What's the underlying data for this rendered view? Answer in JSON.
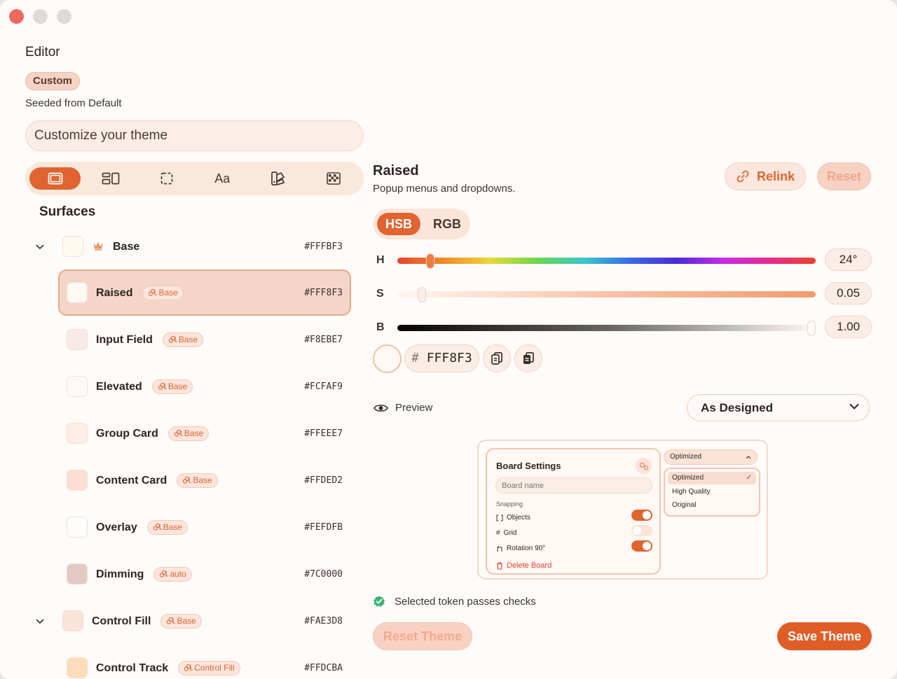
{
  "editor": {
    "title": "Editor",
    "badge": "Custom",
    "seeded": "Seeded from Default",
    "theme_input": "Customize your theme",
    "tabs": [
      {
        "name": "surfaces",
        "icon": "surface-icon",
        "active": true
      },
      {
        "name": "layout",
        "icon": "layout-icon",
        "active": false
      },
      {
        "name": "border",
        "icon": "dashed-square-icon",
        "active": false
      },
      {
        "name": "typography",
        "label": "Aa",
        "active": false
      },
      {
        "name": "palette",
        "icon": "swatchbook-icon",
        "active": false
      },
      {
        "name": "pattern",
        "icon": "checker-icon",
        "active": false
      }
    ],
    "section_title": "Surfaces",
    "tokens": [
      {
        "label": "Base",
        "hex": "#FFFBF3",
        "swatch": "#FFFBF3",
        "root": true,
        "crown": true
      },
      {
        "label": "Raised",
        "link": "Base",
        "hex": "#FFF8F3",
        "swatch": "#FFF8F3",
        "selected": true
      },
      {
        "label": "Input Field",
        "link": "Base",
        "hex": "#F8EBE7",
        "swatch": "#F8EBE7"
      },
      {
        "label": "Elevated",
        "link": "Base",
        "hex": "#FCFAF9",
        "swatch": "#FCFAF9"
      },
      {
        "label": "Group Card",
        "link": "Base",
        "hex": "#FFEEE7",
        "swatch": "#FFEEE7"
      },
      {
        "label": "Content Card",
        "link": "Base",
        "hex": "#FFDED2",
        "swatch": "#FFDED2"
      },
      {
        "label": "Overlay",
        "link": "Base",
        "hex": "#FEFDFB",
        "swatch": "#FEFDFB"
      },
      {
        "label": "Dimming",
        "link": "auto",
        "hex": "#7C0000",
        "swatch": "#E3C9C3"
      },
      {
        "label": "Control Fill",
        "link": "Base",
        "hex": "#FAE3D8",
        "swatch": "#FAE3D8",
        "root": true
      },
      {
        "label": "Control Track",
        "link": "Control Fill",
        "hex": "#FFDCBA",
        "swatch": "#FFDCBA"
      }
    ]
  },
  "detail": {
    "title": "Raised",
    "subtitle": "Popup menus and dropdowns.",
    "relink": "Relink",
    "reset": "Reset",
    "modes": [
      "HSB",
      "RGB"
    ],
    "sliders": [
      {
        "label": "H",
        "value": "24°",
        "fraction": 0.07
      },
      {
        "label": "S",
        "value": "0.05",
        "fraction": 0.05
      },
      {
        "label": "B",
        "value": "1.00",
        "fraction": 1.0
      }
    ],
    "hex": "FFF8F3",
    "hash": "#",
    "preview_label": "Preview",
    "preview_mode": "As Designed",
    "checks": "Selected token passes checks",
    "reset_theme": "Reset Theme",
    "save_theme": "Save Theme"
  },
  "preview": {
    "board_title": "Board Settings",
    "board_placeholder": "Board name",
    "snapping": "Snapping",
    "options": [
      {
        "label": "Objects",
        "on": true
      },
      {
        "label": "Grid",
        "on": false
      },
      {
        "label": "Rotation 90°",
        "on": true
      }
    ],
    "delete": "Delete Board",
    "dropdown_value": "Optimized",
    "dropdown_items": [
      "Optimized",
      "High Quality",
      "Original"
    ],
    "check": "✓"
  },
  "colors": {
    "accent": "#E0642F",
    "danger": "#E0422F",
    "success": "#3BB374"
  }
}
